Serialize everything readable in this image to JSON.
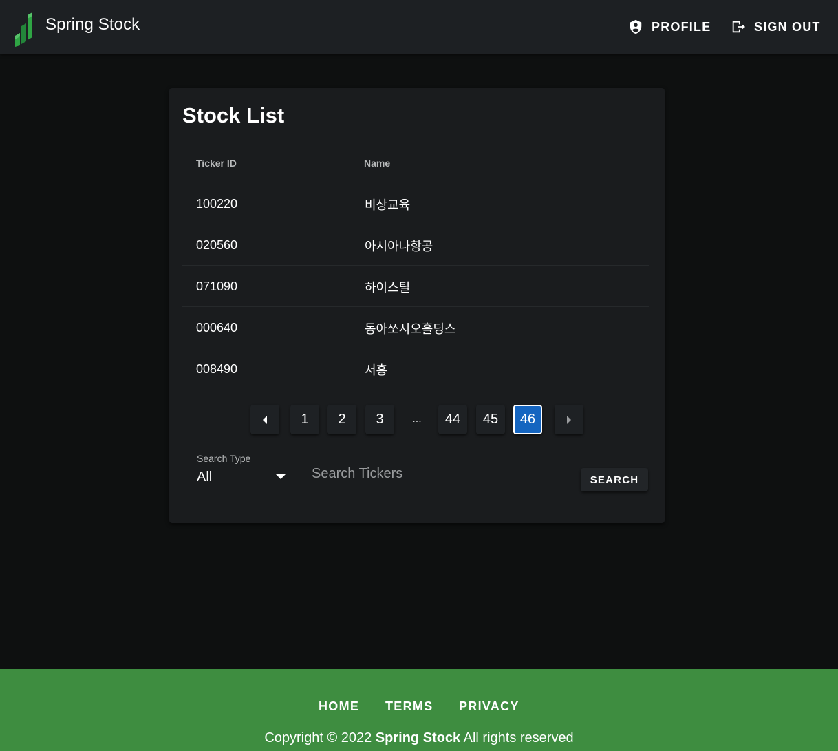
{
  "header": {
    "brand": "Spring Stock",
    "profile_label": "PROFILE",
    "signout_label": "SIGN OUT"
  },
  "card": {
    "title": "Stock List",
    "columns": {
      "id": "Ticker ID",
      "name": "Name"
    },
    "rows": [
      {
        "id": "100220",
        "name": "비상교육"
      },
      {
        "id": "020560",
        "name": "아시아나항공"
      },
      {
        "id": "071090",
        "name": "하이스틸"
      },
      {
        "id": "000640",
        "name": "동아쏘시오홀딩스"
      },
      {
        "id": "008490",
        "name": "서흥"
      }
    ]
  },
  "pagination": {
    "pages": [
      "1",
      "2",
      "3",
      "44",
      "45",
      "46"
    ],
    "ellipsis": "...",
    "current": "46"
  },
  "search": {
    "type_label": "Search Type",
    "type_value": "All",
    "placeholder": "Search Tickers",
    "button_label": "SEARCH"
  },
  "footer": {
    "links": [
      "HOME",
      "TERMS",
      "PRIVACY"
    ],
    "copyright_prefix": "Copyright © 2022",
    "copyright_brand": "Spring Stock",
    "copyright_suffix": "All rights reserved"
  },
  "colors": {
    "background": "#0e1010",
    "appbar": "#1d2023",
    "card": "#1a1c1e",
    "accent_active_page": "#1565c0",
    "footer": "#3e8d40",
    "logo_green": "#2e9a3e"
  },
  "icons": {
    "logo": "bar-chart-logo-icon",
    "profile": "shield-account-icon",
    "signout": "logout-icon",
    "prev": "chevron-left-icon",
    "next": "chevron-right-icon",
    "select": "caret-down-icon"
  }
}
